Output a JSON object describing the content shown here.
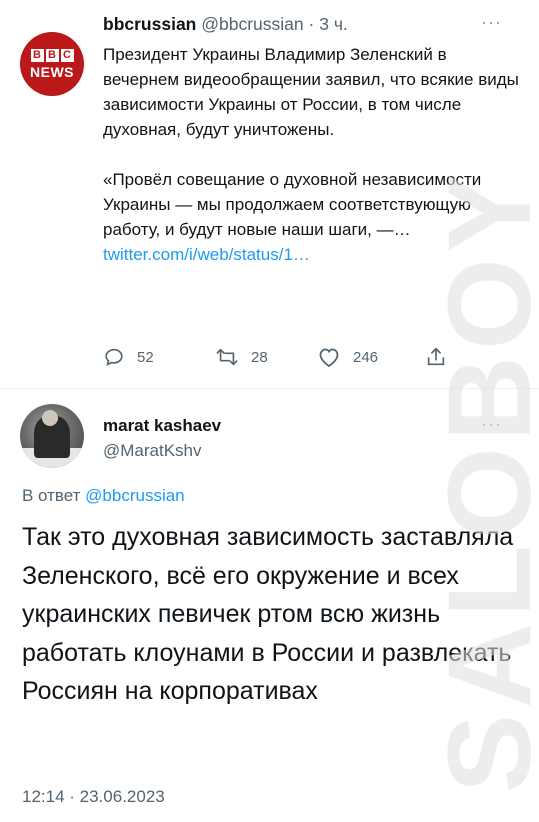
{
  "tweet1": {
    "author_name": "bbcrussian",
    "author_handle": "@bbcrussian",
    "time_sep": " · ",
    "time": "3 ч.",
    "avatar_logo": "BBC",
    "avatar_logo_sub": "NEWS",
    "text_para1": "Президент Украины Владимир Зеленский в вечернем видеообращении заявил, что всякие виды зависимости Украины от России, в том числе духовная, будут уничтожены.",
    "text_quote": "«Провёл совещание о духовной независимости Украины — мы продолжаем соответствующую работу, и будут новые наши шаги, —…",
    "link": "twitter.com/i/web/status/1…",
    "replies": "52",
    "retweets": "28",
    "likes": "246",
    "more_label": "···"
  },
  "tweet2": {
    "author_name": "marat kashaev",
    "author_handle": "@MaratKshv",
    "more_label": "···",
    "reply_prefix": "В ответ ",
    "reply_to": "@bbcrussian",
    "text": "Так это духовная зависимость заставляла Зеленского, всё его окружение и всех украинских певичек ртом всю жизнь работать клоунами в России и развлекать Россиян на корпоративах",
    "timestamp": "12:14 · 23.06.2023"
  },
  "watermark": "SALOBOY",
  "icons": {
    "reply": "reply-icon",
    "retweet": "retweet-icon",
    "like": "heart-icon",
    "share": "share-icon"
  }
}
